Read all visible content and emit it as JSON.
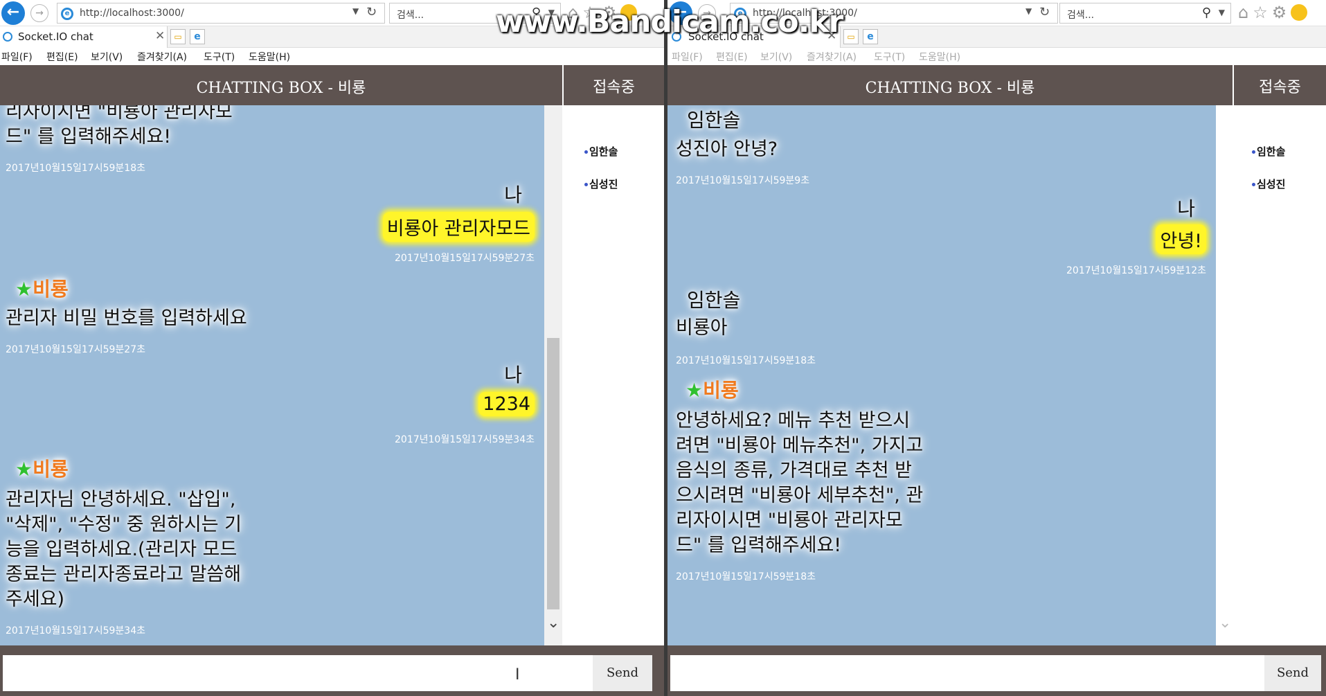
{
  "watermark": "www.Bandicam.co.kr",
  "browser": {
    "back_glyph": "←",
    "forward_glyph": "→",
    "url": "http://localhost:3000/",
    "search_placeholder": "검색...",
    "tab_title": "Socket.IO chat",
    "menu": [
      "파일(F)",
      "편집(E)",
      "보기(V)",
      "즐겨찾기(A)",
      "도구(T)",
      "도움말(H)"
    ]
  },
  "app": {
    "title": "CHATTING BOX - 비룡",
    "users_title": "접속중",
    "send_label": "Send",
    "users": [
      "임한솔",
      "심성진"
    ]
  },
  "left_chat": {
    "msg1_text_line1": "리자이시면 \"비룡아 관리자모",
    "msg1_text_line2": "드\" 를 입력해주세요!",
    "msg1_time": "2017년10월15일17시59분18초",
    "msg2_sender": "나",
    "msg2_text": "비룡아 관리자모드",
    "msg2_time": "2017년10월15일17시59분27초",
    "msg3_sender": "비룡",
    "msg3_text": "관리자 비밀 번호를 입력하세요",
    "msg3_time": "2017년10월15일17시59분27초",
    "msg4_sender": "나",
    "msg4_text": "1234",
    "msg4_time": "2017년10월15일17시59분34초",
    "msg5_sender": "비룡",
    "msg5_lines": [
      "관리자님 안녕하세요. \"삽입\",",
      "\"삭제\", \"수정\" 중 원하시는 기",
      "능을 입력하세요.(관리자 모드",
      "종료는 관리자종료라고 말씀해",
      "주세요)"
    ],
    "msg5_time": "2017년10월15일17시59분34초"
  },
  "right_chat": {
    "msg1_sender": "임한솔",
    "msg1_text": "성진아 안녕?",
    "msg1_time": "2017년10월15일17시59분9초",
    "msg2_sender": "나",
    "msg2_text": "안녕!",
    "msg2_time": "2017년10월15일17시59분12초",
    "msg3_sender": "임한솔",
    "msg3_text": "비룡아",
    "msg3_time": "2017년10월15일17시59분18초",
    "msg4_sender": "비룡",
    "msg4_lines": [
      "안녕하세요? 메뉴 추천 받으시",
      "려면 \"비룡아 메뉴추천\", 가지고",
      "음식의 종류, 가격대로 추천 받",
      "으시려면 \"비룡아 세부추천\", 관",
      "리자이시면 \"비룡아 관리자모",
      "드\" 를 입력해주세요!"
    ],
    "msg4_time": "2017년10월15일17시59분18초"
  },
  "colors": {
    "header_bg": "#5e5350",
    "chat_bg": "#9cbcd9",
    "my_bubble": "#fff52a",
    "bot_name": "#f07a1e",
    "bot_star": "#2ec02e"
  }
}
